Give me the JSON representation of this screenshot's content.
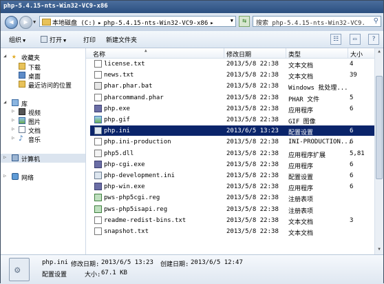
{
  "window": {
    "title": "php-5.4.15-nts-Win32-VC9-x86"
  },
  "address": {
    "crumbs": [
      "本地磁盘 (C:)",
      "▸",
      "php-5.4.15-nts-Win32-VC9-x86",
      "▸"
    ],
    "search_placeholder": "搜索 php-5.4.15-nts-Win32-VC9..."
  },
  "toolbar": {
    "organize": "组织",
    "open": "打开",
    "print": "打印",
    "new_folder": "新建文件夹"
  },
  "nav": {
    "favorites": "收藏夹",
    "downloads": "下载",
    "desktop": "桌面",
    "recent": "最近访问的位置",
    "libraries": "库",
    "videos": "视频",
    "pictures": "图片",
    "documents": "文档",
    "music": "音乐",
    "computer": "计算机",
    "network": "网络"
  },
  "columns": {
    "name": "名称",
    "date": "修改日期",
    "type": "类型",
    "size": "大小"
  },
  "files": [
    {
      "name": "license.txt",
      "date": "2013/5/8 22:38",
      "type": "文本文档",
      "size": "4",
      "icon": "txt"
    },
    {
      "name": "news.txt",
      "date": "2013/5/8 22:38",
      "type": "文本文档",
      "size": "39",
      "icon": "txt"
    },
    {
      "name": "phar.phar.bat",
      "date": "2013/5/8 22:38",
      "type": "Windows 批处理...",
      "size": "",
      "icon": "bat"
    },
    {
      "name": "pharcommand.phar",
      "date": "2013/5/8 22:38",
      "type": "PHAR 文件",
      "size": "5",
      "icon": "txt"
    },
    {
      "name": "php.exe",
      "date": "2013/5/8 22:38",
      "type": "应用程序",
      "size": "6",
      "icon": "php"
    },
    {
      "name": "php.gif",
      "date": "2013/5/8 22:38",
      "type": "GIF 图像",
      "size": "",
      "icon": "gif"
    },
    {
      "name": "php.ini",
      "date": "2013/6/5 13:23",
      "type": "配置设置",
      "size": "6",
      "icon": "ini",
      "selected": true
    },
    {
      "name": "php.ini-production",
      "date": "2013/5/8 22:38",
      "type": "INI-PRODUCTION...",
      "size": "6",
      "icon": "txt"
    },
    {
      "name": "php5.dll",
      "date": "2013/5/8 22:38",
      "type": "应用程序扩展",
      "size": "5,81",
      "icon": "dll"
    },
    {
      "name": "php-cgi.exe",
      "date": "2013/5/8 22:38",
      "type": "应用程序",
      "size": "6",
      "icon": "php"
    },
    {
      "name": "php-development.ini",
      "date": "2013/5/8 22:38",
      "type": "配置设置",
      "size": "6",
      "icon": "ini"
    },
    {
      "name": "php-win.exe",
      "date": "2013/5/8 22:38",
      "type": "应用程序",
      "size": "6",
      "icon": "php"
    },
    {
      "name": "pws-php5cgi.reg",
      "date": "2013/5/8 22:38",
      "type": "注册表项",
      "size": "",
      "icon": "reg"
    },
    {
      "name": "pws-php5isapi.reg",
      "date": "2013/5/8 22:38",
      "type": "注册表项",
      "size": "",
      "icon": "reg"
    },
    {
      "name": "readme-redist-bins.txt",
      "date": "2013/5/8 22:38",
      "type": "文本文档",
      "size": "3",
      "icon": "txt"
    },
    {
      "name": "snapshot.txt",
      "date": "2013/5/8 22:38",
      "type": "文本文档",
      "size": "",
      "icon": "txt"
    }
  ],
  "details": {
    "filename": "php.ini",
    "modified_label": "修改日期:",
    "modified_value": "2013/6/5 13:23",
    "created_label": "创建日期:",
    "created_value": "2013/6/5 12:47",
    "type": "配置设置",
    "size_label": "大小:",
    "size_value": "67.1 KB"
  }
}
